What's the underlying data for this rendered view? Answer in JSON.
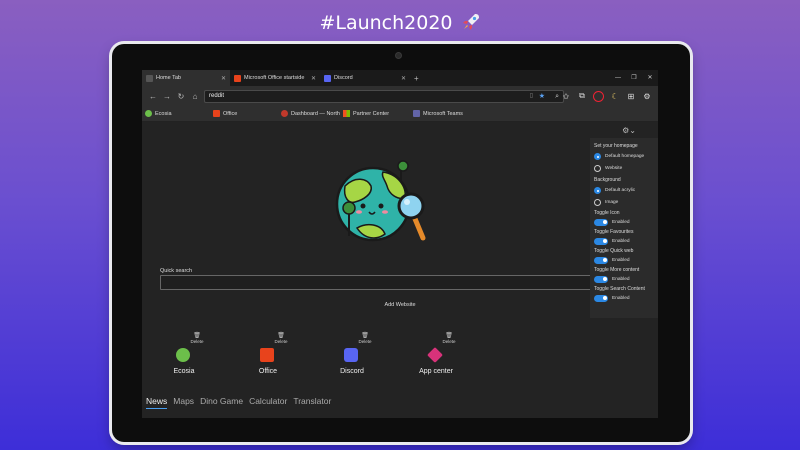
{
  "headline": "#Launch2020",
  "browser": {
    "tabs": [
      {
        "label": "Home Tab",
        "active": true
      },
      {
        "label": "Microsoft Office startside",
        "active": false
      },
      {
        "label": "Discord",
        "active": false
      }
    ],
    "address": "reddit",
    "favorites": [
      "Ecosia",
      "Office",
      "Dashboard — North",
      "Partner Center",
      "Microsoft Teams"
    ]
  },
  "page": {
    "quick_search_label": "Quick search",
    "add_website": "Add Website",
    "delete_label": "Delete",
    "tiles": [
      {
        "name": "Ecosia",
        "color": "#6cbf4a"
      },
      {
        "name": "Office",
        "color": "#e8431c"
      },
      {
        "name": "Discord",
        "color": "#5865f2"
      },
      {
        "name": "App center",
        "color": "#d8327a"
      }
    ],
    "bottom_tabs": [
      "News",
      "Maps",
      "Dino Game",
      "Calculator",
      "Translator"
    ]
  },
  "settings": {
    "homepage_heading": "Set your homepage",
    "homepage_options": [
      "Default homepage",
      "Website"
    ],
    "background_heading": "Background",
    "background_options": [
      "Default acrylic",
      "Image"
    ],
    "toggles": [
      {
        "label": "Toggle Icon",
        "state": "Enabled"
      },
      {
        "label": "Toggle Favourites",
        "state": "Enabled"
      },
      {
        "label": "Toggle Quick web",
        "state": "Enabled"
      },
      {
        "label": "Toggle More content",
        "state": "Enabled"
      },
      {
        "label": "Toggle Search Content",
        "state": "Enabled"
      }
    ]
  },
  "colors": {
    "accent": "#2b88e4",
    "page_bg": "#232323"
  }
}
